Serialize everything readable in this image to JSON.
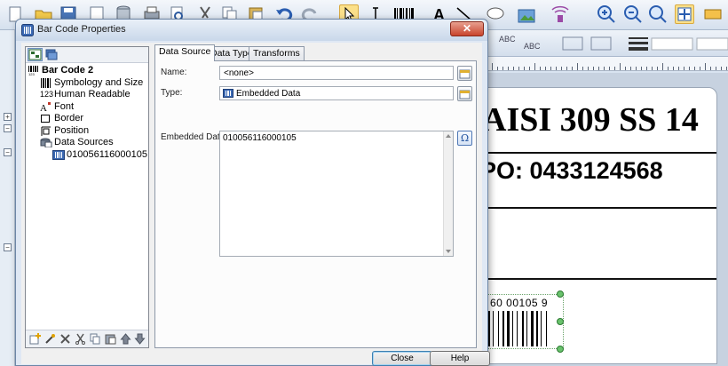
{
  "dialog": {
    "title": "Bar Code Properties",
    "close_glyph": "✕",
    "close_button": "Close",
    "help_button": "Help"
  },
  "tree": {
    "root": "Bar Code 2",
    "items": [
      {
        "label": "Symbology and Size",
        "icon": "barcode-icon"
      },
      {
        "label": "Human Readable",
        "icon": "numbers-123-icon"
      },
      {
        "label": "Font",
        "icon": "font-icon"
      },
      {
        "label": "Border",
        "icon": "border-icon"
      },
      {
        "label": "Position",
        "icon": "position-icon"
      },
      {
        "label": "Data Sources",
        "icon": "data-sources-icon"
      },
      {
        "label": "010056116000105",
        "icon": "embedded-data-icon"
      }
    ],
    "root_icon_label": "123",
    "human_readable_icon_label": "123",
    "font_icon_label": "A"
  },
  "tabs": [
    "Data Source",
    "Data Type",
    "Transforms"
  ],
  "form": {
    "name_label": "Name:",
    "name_value": "<none>",
    "type_label": "Type:",
    "type_value": "Embedded Data",
    "embedded_label": "Embedded Data:",
    "embedded_value": "010056116000105",
    "special_char_glyph": "Ω"
  },
  "label_preview": {
    "line1": "AISI 309 SS 14",
    "line2": "PO: 0433124568",
    "barcode_text": "60 00105 9"
  },
  "colors": {
    "dialog_bg": "#dfe8f4",
    "active_tool": "#fbe08a",
    "close_red": "#c8442c",
    "selection_handle": "#69c26c"
  }
}
